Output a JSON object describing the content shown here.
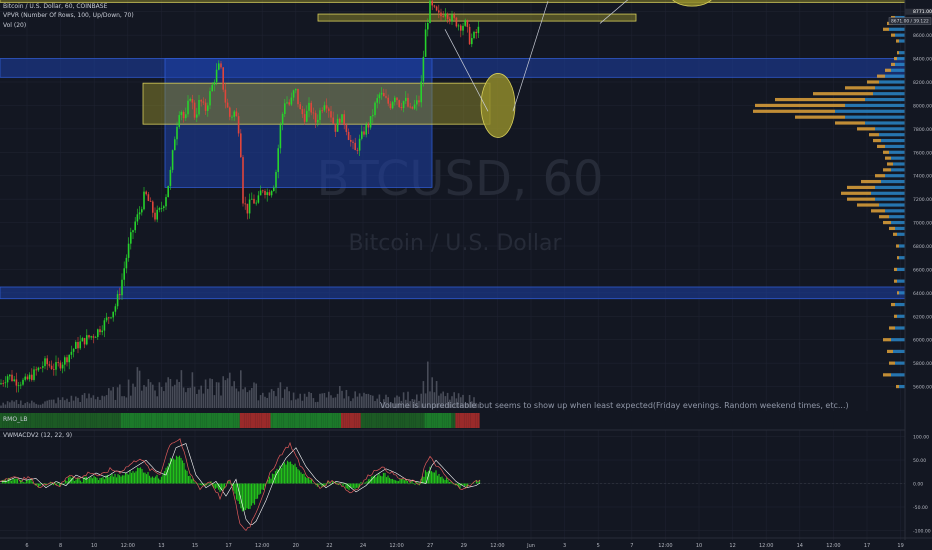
{
  "legend": {
    "symbol": "Bitcoin / U.S. Dollar, 60, COINBASE",
    "vpvr": "VPVR (Number Of Rows, 100, Up/Down, 70)",
    "vol": "Vol (20)",
    "rmo": "RMO_LB",
    "macd": "VWMACDV2 (12, 22, 9)"
  },
  "watermark": {
    "ticker": "BTCUSD, 60",
    "name": "Bitcoin / U.S. Dollar"
  },
  "annotation": "Volume is unpredictable but seems to show up when least expected(Friday evenings. Random weekend times, etc...)",
  "price_badges": {
    "last": "8771.00",
    "crosshair": "8671.00 / 39.122"
  },
  "colors": {
    "background": "#131722",
    "grid": "#1e2230",
    "up": "#26d32c",
    "down": "#e0453b",
    "zone_blue": "#1d3fa8",
    "zone_yellow": "#8f8a2a",
    "vp_up": "#2a86c8",
    "vp_down": "#e0a23a",
    "macd_fast": "#e05a5a",
    "macd_slow": "#ffffff",
    "macd_hist": "#22c01a"
  },
  "chart_data": [
    {
      "type": "candlestick",
      "title": "Bitcoin / U.S. Dollar, 60, COINBASE",
      "ylim": [
        5400,
        8900
      ],
      "y_ticks": [
        5600,
        5800,
        6000,
        6200,
        6400,
        6600,
        6800,
        7000,
        7200,
        7400,
        7600,
        7800,
        8000,
        8200,
        8400,
        8600,
        8800
      ],
      "x_ticks": [
        "6",
        "8",
        "10",
        "12:00",
        "13",
        "15",
        "17",
        "12:00",
        "20",
        "22",
        "24",
        "12:00",
        "27",
        "29",
        "12:00",
        "Jun",
        "3",
        "5",
        "7",
        "12:00",
        "10",
        "12",
        "12:00",
        "14",
        "12:00",
        "17",
        "19"
      ],
      "price_path": [
        [
          0,
          5620
        ],
        [
          8,
          5700
        ],
        [
          15,
          5650
        ],
        [
          25,
          5640
        ],
        [
          35,
          5720
        ],
        [
          45,
          5800
        ],
        [
          55,
          5760
        ],
        [
          65,
          5830
        ],
        [
          75,
          5940
        ],
        [
          85,
          6000
        ],
        [
          95,
          6050
        ],
        [
          105,
          6150
        ],
        [
          115,
          6280
        ],
        [
          120,
          6420
        ],
        [
          125,
          6650
        ],
        [
          130,
          6850
        ],
        [
          135,
          7000
        ],
        [
          140,
          7100
        ],
        [
          145,
          7250
        ],
        [
          150,
          7150
        ],
        [
          155,
          7050
        ],
        [
          160,
          7100
        ],
        [
          165,
          7200
        ],
        [
          170,
          7400
        ],
        [
          175,
          7750
        ],
        [
          180,
          8000
        ],
        [
          185,
          7850
        ],
        [
          190,
          8100
        ],
        [
          195,
          7900
        ],
        [
          200,
          8050
        ],
        [
          205,
          7950
        ],
        [
          210,
          8100
        ],
        [
          215,
          8250
        ],
        [
          220,
          8350
        ],
        [
          225,
          8050
        ],
        [
          230,
          7900
        ],
        [
          235,
          7950
        ],
        [
          240,
          7750
        ],
        [
          243,
          7200
        ],
        [
          247,
          7100
        ],
        [
          252,
          7200
        ],
        [
          257,
          7150
        ],
        [
          262,
          7300
        ],
        [
          268,
          7250
        ],
        [
          275,
          7350
        ],
        [
          280,
          7800
        ],
        [
          285,
          8050
        ],
        [
          290,
          8000
        ],
        [
          295,
          8150
        ],
        [
          300,
          7950
        ],
        [
          305,
          7900
        ],
        [
          310,
          8000
        ],
        [
          315,
          7850
        ],
        [
          320,
          7950
        ],
        [
          325,
          8050
        ],
        [
          330,
          7950
        ],
        [
          335,
          7800
        ],
        [
          340,
          7900
        ],
        [
          345,
          7850
        ],
        [
          350,
          7700
        ],
        [
          355,
          7600
        ],
        [
          360,
          7700
        ],
        [
          365,
          7800
        ],
        [
          370,
          7850
        ],
        [
          375,
          8000
        ],
        [
          380,
          8100
        ],
        [
          385,
          8050
        ],
        [
          390,
          8000
        ],
        [
          395,
          8100
        ],
        [
          400,
          8000
        ],
        [
          405,
          8050
        ],
        [
          410,
          7950
        ],
        [
          415,
          8000
        ],
        [
          420,
          8050
        ],
        [
          425,
          8600
        ],
        [
          430,
          8850
        ],
        [
          435,
          8800
        ],
        [
          440,
          8750
        ],
        [
          445,
          8820
        ],
        [
          450,
          8750
        ],
        [
          455,
          8720
        ],
        [
          460,
          8680
        ],
        [
          465,
          8700
        ],
        [
          470,
          8550
        ],
        [
          475,
          8600
        ],
        [
          480,
          8670
        ]
      ],
      "zones": [
        {
          "kind": "blue",
          "from": 8240,
          "to": 8400,
          "x0": 0,
          "x1": 905
        },
        {
          "kind": "blue",
          "from": 6350,
          "to": 6450,
          "x0": 0,
          "x1": 905
        },
        {
          "kind": "blue",
          "from": 7300,
          "to": 8400,
          "x0": 165,
          "x1": 432
        },
        {
          "kind": "yellow",
          "from": 7840,
          "to": 8190,
          "x0": 143,
          "x1": 490
        },
        {
          "kind": "yellow",
          "from": 8720,
          "to": 8780,
          "x0": 318,
          "x1": 636
        },
        {
          "kind": "yellow",
          "from": 8880,
          "to": 8950,
          "x0": 0,
          "x1": 905
        }
      ]
    },
    {
      "type": "bar",
      "title": "Vol (20)",
      "description_free": true,
      "values_path": [
        [
          0,
          4
        ],
        [
          20,
          6
        ],
        [
          40,
          5
        ],
        [
          60,
          8
        ],
        [
          80,
          10
        ],
        [
          100,
          12
        ],
        [
          120,
          16
        ],
        [
          140,
          30
        ],
        [
          160,
          20
        ],
        [
          180,
          35
        ],
        [
          200,
          18
        ],
        [
          220,
          22
        ],
        [
          240,
          28
        ],
        [
          260,
          14
        ],
        [
          280,
          18
        ],
        [
          300,
          12
        ],
        [
          320,
          10
        ],
        [
          340,
          16
        ],
        [
          360,
          11
        ],
        [
          380,
          9
        ],
        [
          400,
          10
        ],
        [
          420,
          14
        ],
        [
          428,
          34
        ],
        [
          440,
          12
        ],
        [
          460,
          10
        ],
        [
          480,
          8
        ]
      ]
    },
    {
      "type": "bar",
      "title": "VPVR (Number Of Rows, 100, Up/Down, 70)",
      "orientation": "horizontal",
      "rows": [
        [
          8750,
          10,
          4
        ],
        [
          8700,
          12,
          6
        ],
        [
          8650,
          16,
          6
        ],
        [
          8600,
          10,
          4
        ],
        [
          8550,
          6,
          3
        ],
        [
          8450,
          6,
          2
        ],
        [
          8400,
          8,
          3
        ],
        [
          8350,
          10,
          4
        ],
        [
          8300,
          14,
          6
        ],
        [
          8250,
          20,
          8
        ],
        [
          8200,
          26,
          12
        ],
        [
          8150,
          30,
          30
        ],
        [
          8100,
          32,
          60
        ],
        [
          8050,
          40,
          90
        ],
        [
          8000,
          60,
          90
        ],
        [
          7950,
          70,
          82
        ],
        [
          7900,
          60,
          50
        ],
        [
          7850,
          40,
          30
        ],
        [
          7800,
          30,
          18
        ],
        [
          7750,
          26,
          10
        ],
        [
          7700,
          24,
          8
        ],
        [
          7650,
          20,
          8
        ],
        [
          7600,
          16,
          6
        ],
        [
          7550,
          14,
          6
        ],
        [
          7500,
          12,
          6
        ],
        [
          7450,
          14,
          8
        ],
        [
          7400,
          20,
          10
        ],
        [
          7350,
          24,
          20
        ],
        [
          7300,
          30,
          28
        ],
        [
          7250,
          34,
          30
        ],
        [
          7200,
          30,
          28
        ],
        [
          7150,
          26,
          22
        ],
        [
          7100,
          20,
          14
        ],
        [
          7050,
          16,
          10
        ],
        [
          7000,
          14,
          8
        ],
        [
          6950,
          10,
          6
        ],
        [
          6900,
          8,
          4
        ],
        [
          6800,
          6,
          3
        ],
        [
          6700,
          6,
          2
        ],
        [
          6600,
          8,
          3
        ],
        [
          6500,
          8,
          3
        ],
        [
          6400,
          6,
          2
        ],
        [
          6300,
          10,
          4
        ],
        [
          6200,
          8,
          3
        ],
        [
          6100,
          10,
          6
        ],
        [
          6000,
          14,
          8
        ],
        [
          5900,
          12,
          6
        ],
        [
          5800,
          10,
          6
        ],
        [
          5700,
          14,
          8
        ],
        [
          5600,
          6,
          3
        ]
      ]
    },
    {
      "type": "line",
      "title": "VWMACDV2 (12, 22, 9)",
      "ylim": [
        -110,
        110
      ],
      "y_ticks": [
        -100,
        -50,
        0,
        50,
        100
      ],
      "series": [
        {
          "name": "",
          "points": [
            [
              0,
              5
            ],
            [
              10,
              15
            ],
            [
              20,
              8
            ],
            [
              30,
              12
            ],
            [
              40,
              -10
            ],
            [
              50,
              5
            ],
            [
              60,
              -5
            ],
            [
              70,
              20
            ],
            [
              80,
              10
            ],
            [
              90,
              25
            ],
            [
              100,
              15
            ],
            [
              110,
              30
            ],
            [
              120,
              25
            ],
            [
              130,
              40
            ],
            [
              140,
              55
            ],
            [
              150,
              30
            ],
            [
              160,
              20
            ],
            [
              170,
              85
            ],
            [
              180,
              95
            ],
            [
              190,
              20
            ],
            [
              200,
              -10
            ],
            [
              210,
              5
            ],
            [
              220,
              -30
            ],
            [
              230,
              10
            ],
            [
              240,
              -85
            ],
            [
              245,
              -100
            ],
            [
              250,
              -90
            ],
            [
              260,
              -40
            ],
            [
              270,
              20
            ],
            [
              280,
              60
            ],
            [
              290,
              85
            ],
            [
              300,
              40
            ],
            [
              310,
              10
            ],
            [
              320,
              -10
            ],
            [
              330,
              5
            ],
            [
              340,
              0
            ],
            [
              350,
              -20
            ],
            [
              360,
              -5
            ],
            [
              370,
              20
            ],
            [
              380,
              35
            ],
            [
              390,
              25
            ],
            [
              400,
              10
            ],
            [
              410,
              5
            ],
            [
              420,
              0
            ],
            [
              425,
              40
            ],
            [
              430,
              55
            ],
            [
              440,
              30
            ],
            [
              450,
              5
            ],
            [
              460,
              -10
            ],
            [
              470,
              -5
            ],
            [
              480,
              10
            ]
          ]
        }
      ]
    }
  ]
}
